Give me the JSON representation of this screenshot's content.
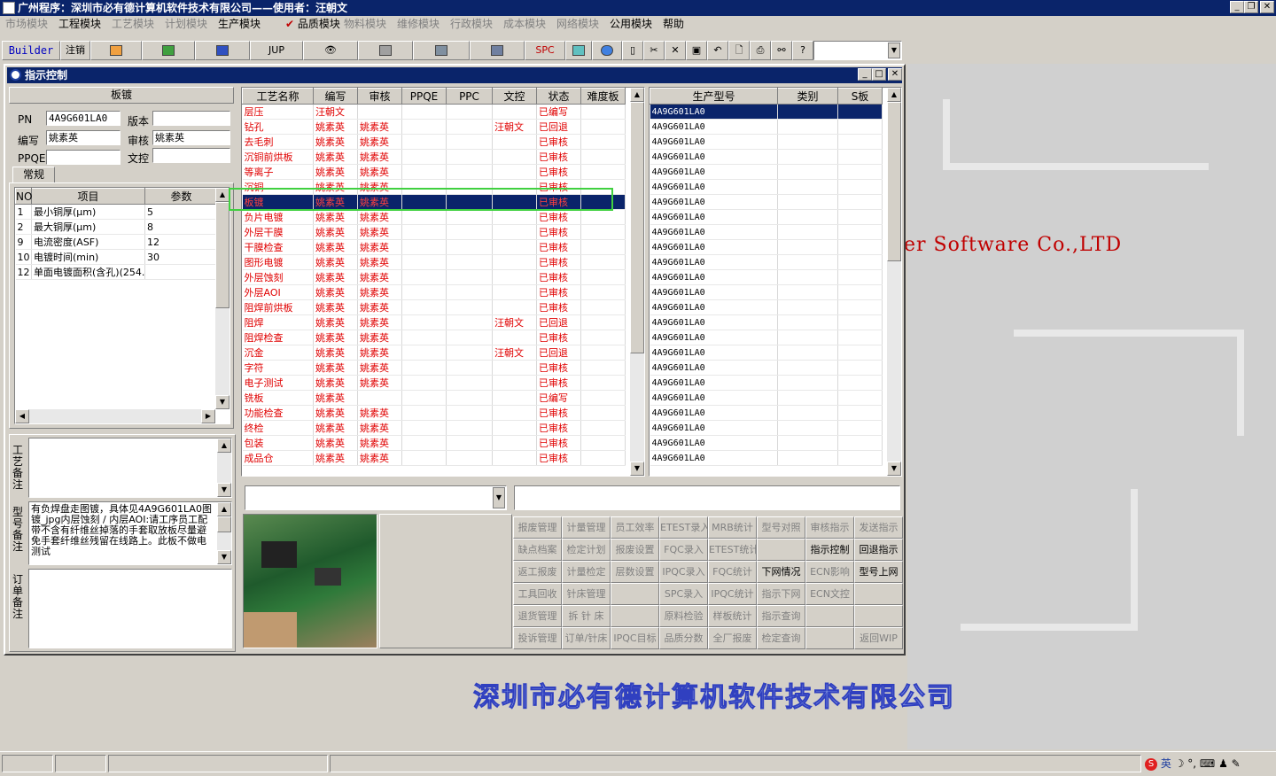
{
  "app": {
    "title": "广州程序：深圳市必有德计算机软件技术有限公司——使用者：汪朝文"
  },
  "menu": [
    {
      "label": "市场模块",
      "enabled": false
    },
    {
      "label": "工程模块",
      "enabled": true
    },
    {
      "label": "工艺模块",
      "enabled": false
    },
    {
      "label": "计划模块",
      "enabled": false
    },
    {
      "label": "生产模块",
      "enabled": true
    },
    {
      "label": "品质模块",
      "enabled": true,
      "checked": true
    },
    {
      "label": "物料模块",
      "enabled": false
    },
    {
      "label": "维修模块",
      "enabled": false
    },
    {
      "label": "行政模块",
      "enabled": false
    },
    {
      "label": "成本模块",
      "enabled": false
    },
    {
      "label": "网络模块",
      "enabled": false
    },
    {
      "label": "公用模块",
      "enabled": true
    },
    {
      "label": "帮助",
      "enabled": true
    }
  ],
  "toolbar": {
    "builder": "Builder",
    "logout": "注销",
    "jup": "JUP",
    "spc": "SPC"
  },
  "window": {
    "title": "指示控制"
  },
  "left": {
    "header": "板镀",
    "pn_label": "PN",
    "pn_value": "4A9G601LA0",
    "version_label": "版本",
    "version_value": "",
    "author_label": "编写",
    "author_value": "姚素英",
    "review_label": "审核",
    "review_value": "姚素英",
    "ppqe_label": "PPQE",
    "ppqe_value": "",
    "doc_label": "文控",
    "doc_value": "",
    "tab": "常规",
    "param_cols": [
      "NO",
      "项目",
      "参数"
    ],
    "params": [
      {
        "no": "1",
        "item": "最小铜厚(μm)",
        "val": "5"
      },
      {
        "no": "2",
        "item": "最大铜厚(μm)",
        "val": "8"
      },
      {
        "no": "9",
        "item": "电流密度(ASF)",
        "val": "12"
      },
      {
        "no": "10",
        "item": "电镀时间(min)",
        "val": "30"
      },
      {
        "no": "12",
        "item": "单面电镀面积(含孔)(254.15",
        "val": ""
      }
    ],
    "craft_note_label": "工艺备注",
    "model_note_label": "型号备注",
    "model_note": "有负焊盘走图镀，具体见4A9G601LA0图镀_jpg内层蚀刻 / 内层AOI:请工序员工配带不含有纤维丝掉落的手套取放板尽量避免手套纤维丝残留在线路上。此板不做电测试",
    "order_note_label": "订单备注"
  },
  "process": {
    "cols": [
      "工艺名称",
      "编写",
      "审核",
      "PPQE",
      "PPC",
      "文控",
      "状态",
      "难度板"
    ],
    "rows": [
      {
        "name": "层压",
        "w": "汪朝文",
        "r": "",
        "ppqe": "",
        "ppc": "",
        "doc": "",
        "status": "已编写"
      },
      {
        "name": "钻孔",
        "w": "姚素英",
        "r": "姚素英",
        "ppqe": "",
        "ppc": "",
        "doc": "汪朝文",
        "status": "已回退"
      },
      {
        "name": "去毛刺",
        "w": "姚素英",
        "r": "姚素英",
        "ppqe": "",
        "ppc": "",
        "doc": "",
        "status": "已审核"
      },
      {
        "name": "沉铜前烘板",
        "w": "姚素英",
        "r": "姚素英",
        "ppqe": "",
        "ppc": "",
        "doc": "",
        "status": "已审核"
      },
      {
        "name": "等离子",
        "w": "姚素英",
        "r": "姚素英",
        "ppqe": "",
        "ppc": "",
        "doc": "",
        "status": "已审核"
      },
      {
        "name": "沉铜",
        "w": "姚素英",
        "r": "姚素英",
        "ppqe": "",
        "ppc": "",
        "doc": "",
        "status": "已审核"
      },
      {
        "name": "板镀",
        "w": "姚素英",
        "r": "姚素英",
        "ppqe": "",
        "ppc": "",
        "doc": "",
        "status": "已审核",
        "selected": true
      },
      {
        "name": "负片电镀",
        "w": "姚素英",
        "r": "姚素英",
        "ppqe": "",
        "ppc": "",
        "doc": "",
        "status": "已审核"
      },
      {
        "name": "外层干膜",
        "w": "姚素英",
        "r": "姚素英",
        "ppqe": "",
        "ppc": "",
        "doc": "",
        "status": "已审核"
      },
      {
        "name": "干膜检查",
        "w": "姚素英",
        "r": "姚素英",
        "ppqe": "",
        "ppc": "",
        "doc": "",
        "status": "已审核"
      },
      {
        "name": "图形电镀",
        "w": "姚素英",
        "r": "姚素英",
        "ppqe": "",
        "ppc": "",
        "doc": "",
        "status": "已审核"
      },
      {
        "name": "外层蚀刻",
        "w": "姚素英",
        "r": "姚素英",
        "ppqe": "",
        "ppc": "",
        "doc": "",
        "status": "已审核"
      },
      {
        "name": "外层AOI",
        "w": "姚素英",
        "r": "姚素英",
        "ppqe": "",
        "ppc": "",
        "doc": "",
        "status": "已审核"
      },
      {
        "name": "阻焊前烘板",
        "w": "姚素英",
        "r": "姚素英",
        "ppqe": "",
        "ppc": "",
        "doc": "",
        "status": "已审核"
      },
      {
        "name": "阻焊",
        "w": "姚素英",
        "r": "姚素英",
        "ppqe": "",
        "ppc": "",
        "doc": "汪朝文",
        "status": "已回退"
      },
      {
        "name": "阻焊检查",
        "w": "姚素英",
        "r": "姚素英",
        "ppqe": "",
        "ppc": "",
        "doc": "",
        "status": "已审核"
      },
      {
        "name": "沉金",
        "w": "姚素英",
        "r": "姚素英",
        "ppqe": "",
        "ppc": "",
        "doc": "汪朝文",
        "status": "已回退"
      },
      {
        "name": "字符",
        "w": "姚素英",
        "r": "姚素英",
        "ppqe": "",
        "ppc": "",
        "doc": "",
        "status": "已审核"
      },
      {
        "name": "电子测试",
        "w": "姚素英",
        "r": "姚素英",
        "ppqe": "",
        "ppc": "",
        "doc": "",
        "status": "已审核"
      },
      {
        "name": "铣板",
        "w": "姚素英",
        "r": "",
        "ppqe": "",
        "ppc": "",
        "doc": "",
        "status": "已编写"
      },
      {
        "name": "功能检查",
        "w": "姚素英",
        "r": "姚素英",
        "ppqe": "",
        "ppc": "",
        "doc": "",
        "status": "已审核"
      },
      {
        "name": "终检",
        "w": "姚素英",
        "r": "姚素英",
        "ppqe": "",
        "ppc": "",
        "doc": "",
        "status": "已审核"
      },
      {
        "name": "包装",
        "w": "姚素英",
        "r": "姚素英",
        "ppqe": "",
        "ppc": "",
        "doc": "",
        "status": "已审核"
      },
      {
        "name": "成品仓",
        "w": "姚素英",
        "r": "姚素英",
        "ppqe": "",
        "ppc": "",
        "doc": "",
        "status": "已审核"
      }
    ]
  },
  "models": {
    "cols": [
      "生产型号",
      "类别",
      "S板"
    ],
    "rows": [
      "4A9G601LA0",
      "4A9G601LA0",
      "4A9G601LA0",
      "4A9G601LA0",
      "4A9G601LA0",
      "4A9G601LA0",
      "4A9G601LA0",
      "4A9G601LA0",
      "4A9G601LA0",
      "4A9G601LA0",
      "4A9G601LA0",
      "4A9G601LA0",
      "4A9G601LA0",
      "4A9G601LA0",
      "4A9G601LA0",
      "4A9G601LA0",
      "4A9G601LA0",
      "4A9G601LA0",
      "4A9G601LA0",
      "4A9G601LA0",
      "4A9G601LA0",
      "4A9G601LA0",
      "4A9G601LA0",
      "4A9G601LA0"
    ]
  },
  "buttons": [
    [
      {
        "l": "报废管理",
        "e": false
      },
      {
        "l": "计量管理",
        "e": false
      },
      {
        "l": "员工效率",
        "e": false
      },
      {
        "l": "ETEST录入",
        "e": false
      },
      {
        "l": "MRB统计",
        "e": false
      },
      {
        "l": "型号对照",
        "e": false
      },
      {
        "l": "审核指示",
        "e": false
      },
      {
        "l": "发送指示",
        "e": false
      }
    ],
    [
      {
        "l": "缺点档案",
        "e": false
      },
      {
        "l": "检定计划",
        "e": false
      },
      {
        "l": "报废设置",
        "e": false
      },
      {
        "l": "FQC录入",
        "e": false
      },
      {
        "l": "ETEST统计",
        "e": false
      },
      {
        "l": "",
        "e": false
      },
      {
        "l": "指示控制",
        "e": true
      },
      {
        "l": "回退指示",
        "e": true
      }
    ],
    [
      {
        "l": "返工报废",
        "e": false
      },
      {
        "l": "计量检定",
        "e": false
      },
      {
        "l": "层数设置",
        "e": false
      },
      {
        "l": "IPQC录入",
        "e": false
      },
      {
        "l": "FQC统计",
        "e": false
      },
      {
        "l": "下网情况",
        "e": true
      },
      {
        "l": "ECN影响",
        "e": false
      },
      {
        "l": "型号上网",
        "e": true
      }
    ],
    [
      {
        "l": "工具回收",
        "e": false
      },
      {
        "l": "针床管理",
        "e": false
      },
      {
        "l": "",
        "e": false
      },
      {
        "l": "SPC录入",
        "e": false
      },
      {
        "l": "IPQC统计",
        "e": false
      },
      {
        "l": "指示下网",
        "e": false
      },
      {
        "l": "ECN文控",
        "e": false
      },
      {
        "l": "",
        "e": false
      }
    ],
    [
      {
        "l": "退货管理",
        "e": false
      },
      {
        "l": "拆 针 床",
        "e": false
      },
      {
        "l": "",
        "e": false
      },
      {
        "l": "原料检验",
        "e": false
      },
      {
        "l": "样板统计",
        "e": false
      },
      {
        "l": "指示查询",
        "e": false
      },
      {
        "l": "",
        "e": false
      },
      {
        "l": "",
        "e": false
      }
    ],
    [
      {
        "l": "投诉管理",
        "e": false
      },
      {
        "l": "订单/针床",
        "e": false
      },
      {
        "l": "IPQC目标",
        "e": false
      },
      {
        "l": "品质分数",
        "e": false
      },
      {
        "l": "全厂报废",
        "e": false
      },
      {
        "l": "检定查询",
        "e": false
      },
      {
        "l": "",
        "e": false
      },
      {
        "l": "返回WIP",
        "e": false
      }
    ]
  ],
  "background": {
    "software_text": "er Software Co.,LTD",
    "company_text": "深圳市必有德计算机软件技术有限公司"
  },
  "tray": {
    "ime": "英"
  }
}
